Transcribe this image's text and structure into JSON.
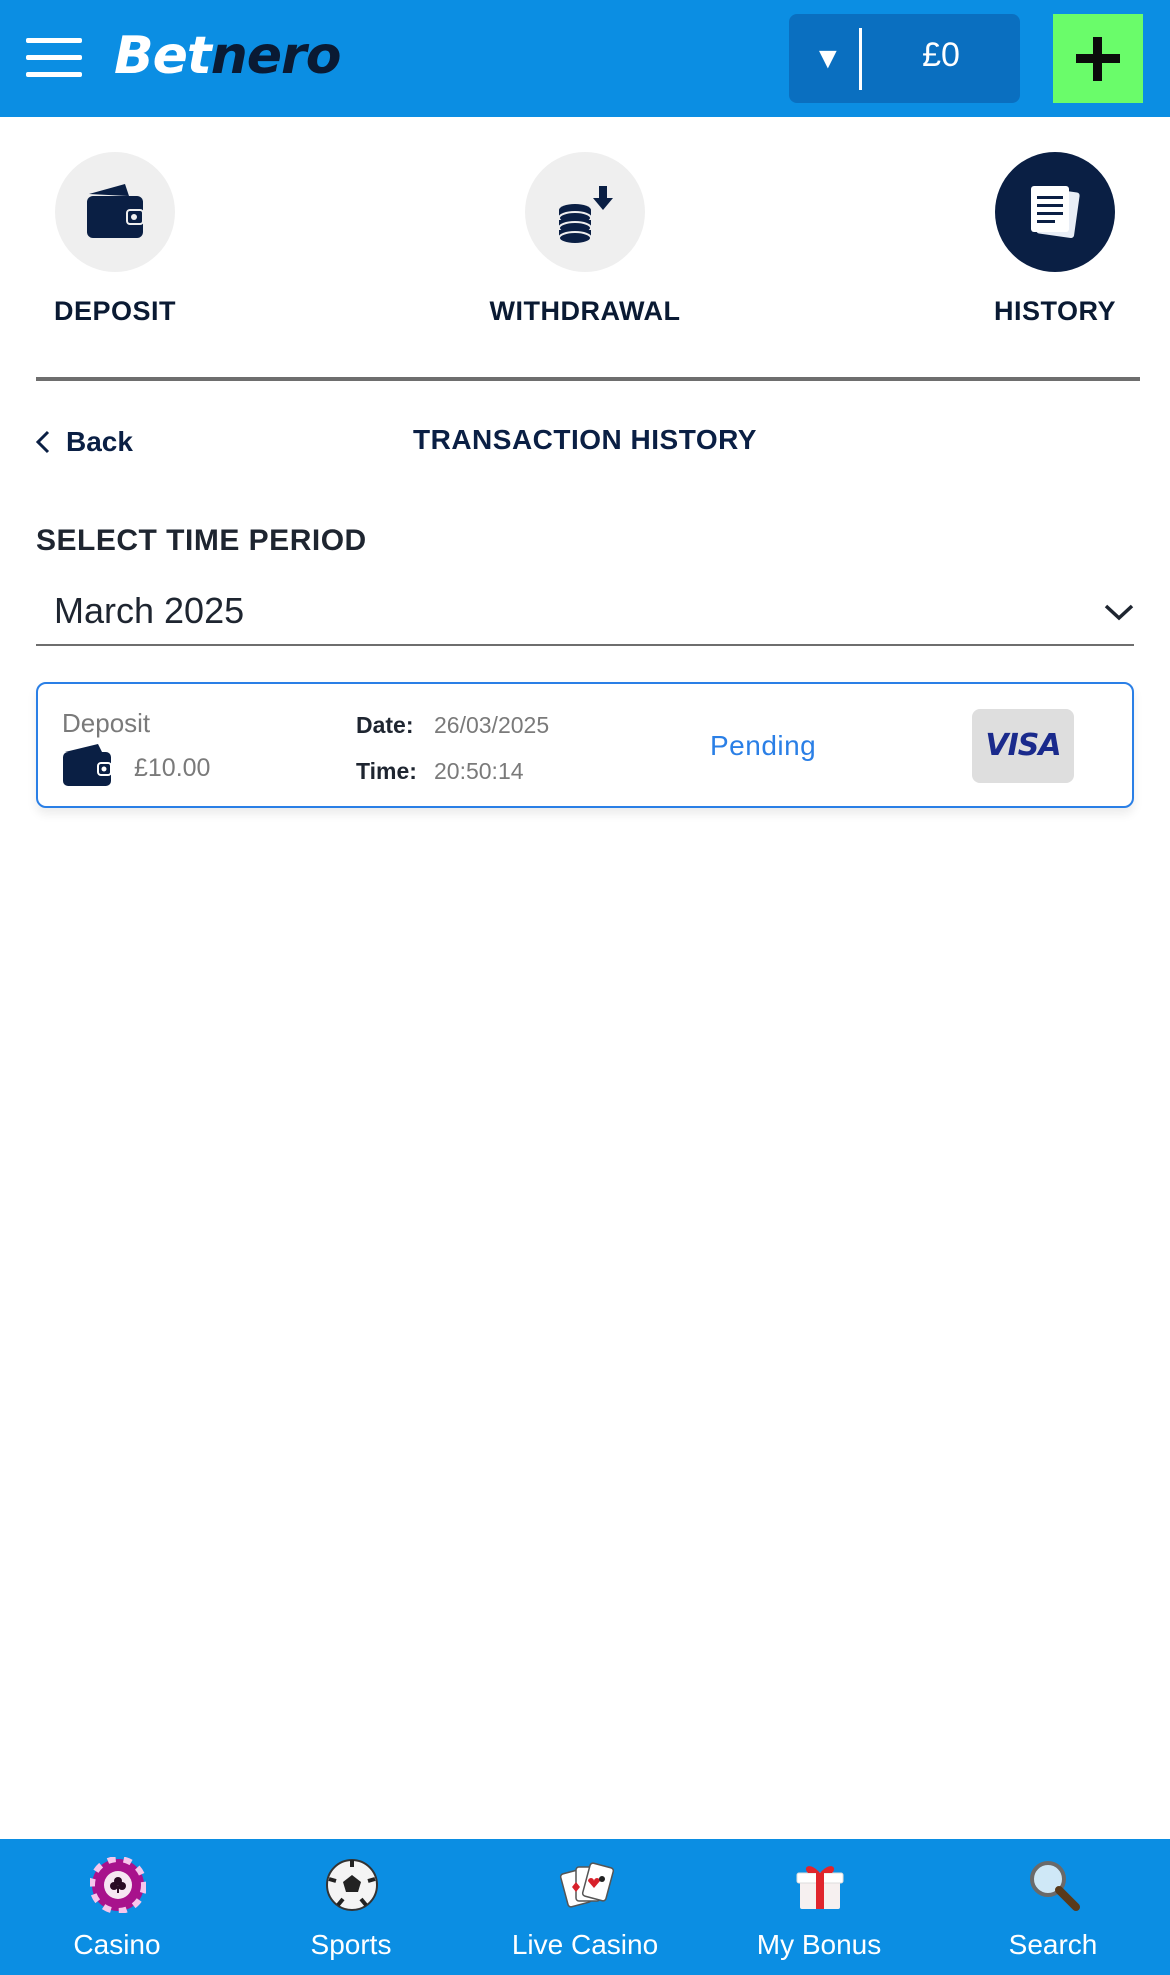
{
  "header": {
    "logo_bet": "Bet",
    "logo_nero": "nero",
    "balance": "£0",
    "balance_caret": "▼"
  },
  "tabs": [
    {
      "label": "DEPOSIT"
    },
    {
      "label": "WITHDRAWAL"
    },
    {
      "label": "HISTORY",
      "active": true
    }
  ],
  "history": {
    "back_label": "Back",
    "title": "TRANSACTION HISTORY",
    "period_label": "SELECT TIME PERIOD",
    "period_value": "March 2025"
  },
  "transactions": [
    {
      "type": "Deposit",
      "amount": "£10.00",
      "date_label": "Date:",
      "date": "26/03/2025",
      "time_label": "Time:",
      "time": "20:50:14",
      "status": "Pending",
      "method": "VISA"
    }
  ],
  "bottom_nav": [
    {
      "label": "Casino",
      "icon": "casino-chip-icon"
    },
    {
      "label": "Sports",
      "icon": "soccer-ball-icon"
    },
    {
      "label": "Live Casino",
      "icon": "playing-cards-icon"
    },
    {
      "label": "My Bonus",
      "icon": "gift-icon"
    },
    {
      "label": "Search",
      "icon": "magnifier-icon"
    }
  ],
  "colors": {
    "header_bg": "#0b8ee3",
    "accent_green": "#6afc6a",
    "navy": "#0a1f44",
    "status_blue": "#2a7fe6"
  }
}
